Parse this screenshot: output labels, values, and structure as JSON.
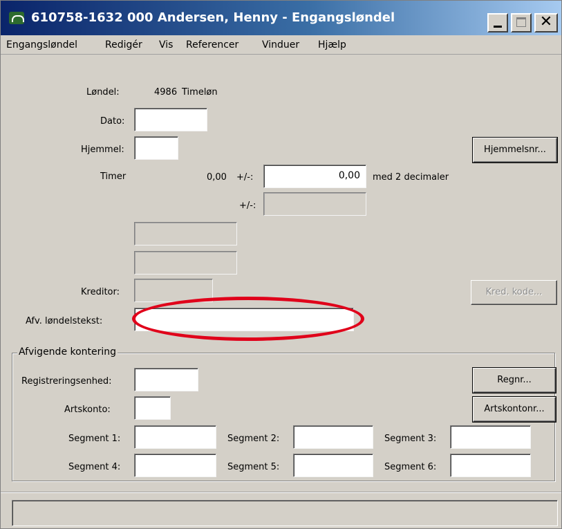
{
  "window": {
    "title": "610758-1632 000 Andersen, Henny - Engangsløndel"
  },
  "menu": {
    "items": [
      {
        "label": "Engangsløndel"
      },
      {
        "label": "Redigér"
      },
      {
        "label": "Vis"
      },
      {
        "label": "Referencer"
      },
      {
        "label": "Vinduer"
      },
      {
        "label": "Hjælp"
      }
    ]
  },
  "form": {
    "londel_label": "Løndel:",
    "londel_code": "4986",
    "londel_name": "Timeløn",
    "dato_label": "Dato:",
    "dato_value": "",
    "hjemmel_label": "Hjemmel:",
    "hjemmel_value": "",
    "hjemmelsnr_button": "Hjemmelsnr...",
    "timer_label": "Timer",
    "timer_value": "0,00",
    "plusminus_label": "+/-:",
    "plusminus_value": "0,00",
    "decimals_label": "med 2 decimaler",
    "plusminus2_label": "+/-:",
    "kreditor_label": "Kreditor:",
    "kred_kode_button": "Kred. kode...",
    "afv_label": "Afv. løndelstekst:",
    "afv_value": ""
  },
  "kontering": {
    "group_title": "Afvigende kontering",
    "regenhed_label": "Registreringsenhed:",
    "regnr_button": "Regnr...",
    "artskonto_label": "Artskonto:",
    "artskontonr_button": "Artskontonr...",
    "segments": [
      {
        "label": "Segment 1:",
        "value": ""
      },
      {
        "label": "Segment 2:",
        "value": ""
      },
      {
        "label": "Segment 3:",
        "value": ""
      },
      {
        "label": "Segment 4:",
        "value": ""
      },
      {
        "label": "Segment 5:",
        "value": ""
      },
      {
        "label": "Segment 6:",
        "value": ""
      }
    ]
  },
  "colors": {
    "window_bg": "#d4d0c8",
    "titlebar_start": "#0a246a",
    "highlight": "#e0001a"
  }
}
